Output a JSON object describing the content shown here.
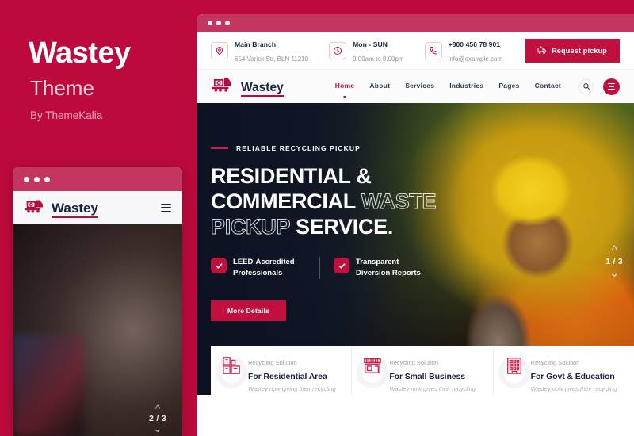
{
  "promo": {
    "title": "Wastey",
    "subtitle": "Theme",
    "author": "By ThemeKalia",
    "brand_color": "#bc0a3c",
    "accent_color": "#c0103e"
  },
  "brand": {
    "name": "Wastey",
    "logo_icon": "dump-truck-icon"
  },
  "desktop": {
    "window": {
      "chrome_color": "#c2365f",
      "dots": 3
    },
    "topbar": {
      "items": [
        {
          "icon": "map-pin-icon",
          "title": "Main Branch",
          "subtitle": "654 Varick Str, BLN 11210"
        },
        {
          "icon": "clock-icon",
          "title": "Mon - SUN",
          "subtitle": "9.00am to 8.00pm"
        },
        {
          "icon": "phone-icon",
          "title": "+800 456 78 901",
          "subtitle": "info@example.com"
        }
      ],
      "cta": {
        "label": "Request pickup",
        "icon": "truck-pickup-icon"
      }
    },
    "nav": {
      "items": [
        {
          "label": "Home",
          "active": true
        },
        {
          "label": "About",
          "active": false
        },
        {
          "label": "Services",
          "active": false
        },
        {
          "label": "Industries",
          "active": false
        },
        {
          "label": "Pages",
          "active": false
        },
        {
          "label": "Contact",
          "active": false
        }
      ],
      "search_icon": "search-icon",
      "menu_icon": "hamburger-icon"
    },
    "hero": {
      "eyebrow": "RELIABLE RECYCLING PICKUP",
      "headline_line1": "RESIDENTIAL &",
      "headline_line2_solid": "COMMERCIAL",
      "headline_line2_outline": "WASTE",
      "headline_line3_outline": "PICKUP",
      "headline_line3_solid": "SERVICE.",
      "features": [
        {
          "icon": "check-icon",
          "text": "LEED-Accredited Professionals"
        },
        {
          "icon": "check-icon",
          "text": "Transparent Diversion Reports"
        }
      ],
      "button": "More Details",
      "slider": {
        "up_icon": "chevron-up-icon",
        "counter": "1 / 3",
        "down_icon": "chevron-down-icon"
      }
    },
    "cards": [
      {
        "icon": "residential-bin-icon",
        "label": "Recycling Solution",
        "title": "For Residential Area",
        "body": "Wastey now giving their recycling"
      },
      {
        "icon": "storefront-icon",
        "label": "Recycling Solution",
        "title": "For Small Business",
        "body": "Wastey now gives their recycling"
      },
      {
        "icon": "government-building-icon",
        "label": "Recycling Solution",
        "title": "For Govt & Education",
        "body": "Wastey now gives their recycling"
      }
    ]
  },
  "mobile": {
    "window": {
      "chrome_color": "#c2365f",
      "dots": 3
    },
    "brand": "Wastey",
    "menu_icon": "hamburger-icon",
    "slider": {
      "up_icon": "chevron-up-icon",
      "counter": "2 / 3",
      "down_icon": "chevron-down-icon"
    }
  }
}
